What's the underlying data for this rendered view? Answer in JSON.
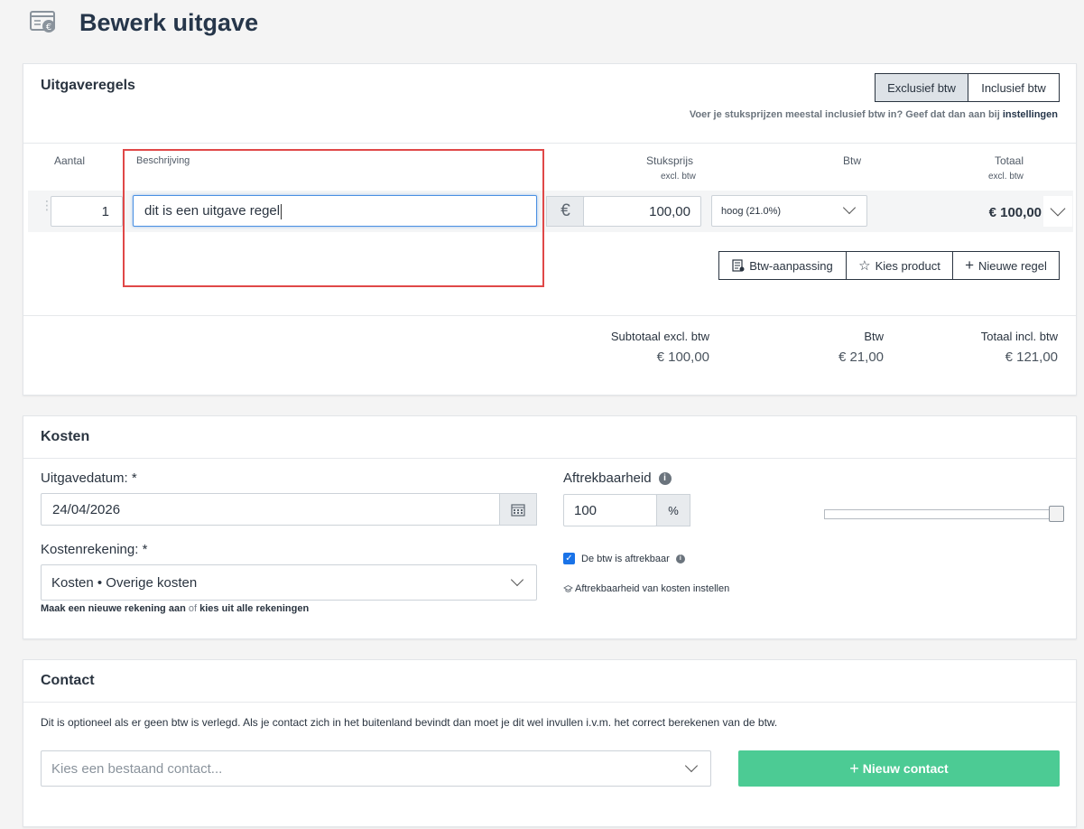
{
  "page": {
    "title": "Bewerk uitgave"
  },
  "lines": {
    "heading": "Uitgaveregels",
    "toggle": {
      "exclusive": "Exclusief btw",
      "inclusive": "Inclusief btw"
    },
    "hint_text": "Voer je stuksprijzen meestal inclusief btw in? Geef dat dan aan bij",
    "hint_link": "instellingen",
    "columns": {
      "quantity": "Aantal",
      "description": "Beschrijving",
      "unit_price": "Stuksprijs",
      "unit_price_sub": "excl. btw",
      "vat": "Btw",
      "total": "Totaal",
      "total_sub": "excl. btw"
    },
    "row": {
      "quantity": "1",
      "description": "dit is een uitgave regel",
      "currency": "€",
      "unit_price": "100,00",
      "vat": "hoog (21.0%)",
      "total": "€ 100,00"
    },
    "actions": {
      "vat_adjust": "Btw-aanpassing",
      "choose_product": "Kies product",
      "new_line": "Nieuwe regel"
    },
    "summary": {
      "subtotal_label": "Subtotaal excl. btw",
      "subtotal_value": "€ 100,00",
      "vat_label": "Btw",
      "vat_value": "€ 21,00",
      "total_label": "Totaal incl. btw",
      "total_value": "€ 121,00"
    }
  },
  "costs": {
    "heading": "Kosten",
    "date_label": "Uitgavedatum: *",
    "date_value": "24/04/2026",
    "deductibility_label": "Aftrekbaarheid",
    "deductibility_value": "100",
    "percent_sign": "%",
    "account_label": "Kostenrekening: *",
    "account_value": "Kosten • Overige kosten",
    "new_account_link": "Maak een nieuwe rekening aan",
    "or_text": "of",
    "choose_all_link": "kies uit alle rekeningen",
    "vat_deductible_label": "De btw is aftrekbaar",
    "settings_link": "Aftrekbaarheid van kosten instellen",
    "slider_value_percent": 100
  },
  "contact": {
    "heading": "Contact",
    "description": "Dit is optioneel als er geen btw is verlegd. Als je contact zich in het buitenland bevindt dan moet je dit wel invullen i.v.m. het correct berekenen van de btw.",
    "select_placeholder": "Kies een bestaand contact...",
    "new_contact": "Nieuw contact"
  },
  "colors": {
    "accent_green": "#4ccb94",
    "highlight_red": "#e04848",
    "focus_blue": "#4a90e2",
    "title_dark": "#26364a"
  }
}
